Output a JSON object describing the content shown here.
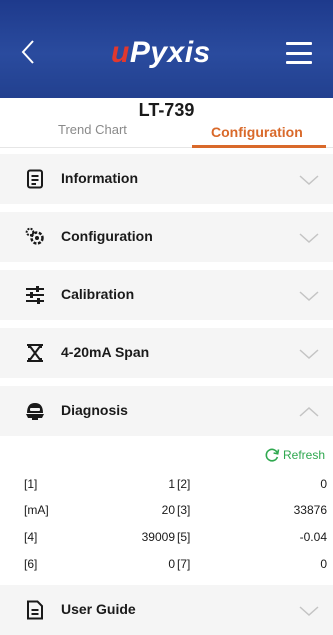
{
  "header": {
    "logo_prefix": "u",
    "logo_main": "Pyxis"
  },
  "device": {
    "title": "LT-739"
  },
  "tabs": {
    "trend": "Trend Chart",
    "config": "Configuration"
  },
  "sections": {
    "information": "Information",
    "configuration": "Configuration",
    "calibration": "Calibration",
    "span": "4-20mA Span",
    "diagnosis": "Diagnosis",
    "guide": "User Guide"
  },
  "diagnosis": {
    "refresh": "Refresh",
    "rows": [
      {
        "k1": "[1]",
        "v1": "1",
        "k2": "[2]",
        "v2": "0"
      },
      {
        "k1": "[mA]",
        "v1": "20",
        "k2": "[3]",
        "v2": "33876"
      },
      {
        "k1": "[4]",
        "v1": "39009",
        "k2": "[5]",
        "v2": "-0.04"
      },
      {
        "k1": "[6]",
        "v1": "0",
        "k2": "[7]",
        "v2": "0"
      }
    ]
  },
  "colors": {
    "header_blue": "#22408f",
    "accent_orange": "#d9692a",
    "refresh_green": "#2fa84f",
    "logo_red": "#e0382f"
  }
}
